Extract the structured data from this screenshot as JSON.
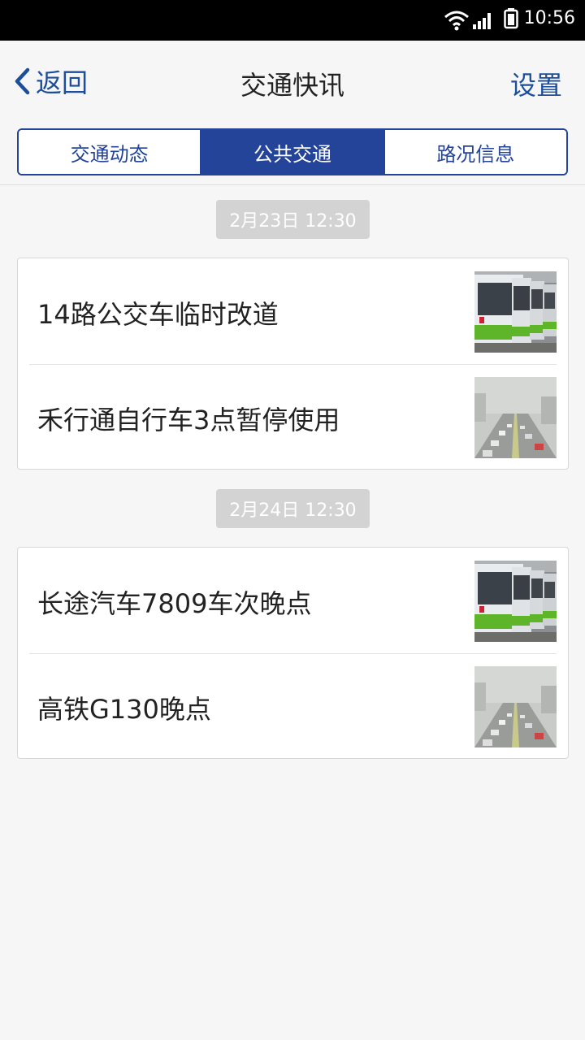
{
  "status_bar": {
    "time": "10:56"
  },
  "nav": {
    "back_label": "返回",
    "title": "交通快讯",
    "settings_label": "设置"
  },
  "tabs": [
    {
      "label": "交通动态",
      "active": false
    },
    {
      "label": "公共交通",
      "active": true
    },
    {
      "label": "路况信息",
      "active": false
    }
  ],
  "groups": [
    {
      "date": "2月23日 12:30",
      "items": [
        {
          "title": "14路公交车临时改道",
          "thumbnail": "bus-photo"
        },
        {
          "title": "禾行通自行车3点暂停使用",
          "thumbnail": "foggy-road-photo"
        }
      ]
    },
    {
      "date": "2月24日 12:30",
      "items": [
        {
          "title": "长途汽车7809车次晚点",
          "thumbnail": "bus-photo"
        },
        {
          "title": "高铁G130晚点",
          "thumbnail": "foggy-road-photo"
        }
      ]
    }
  ],
  "colors": {
    "accent": "#24449a",
    "link": "#1d4e9b",
    "badge": "#d3d3d3"
  }
}
